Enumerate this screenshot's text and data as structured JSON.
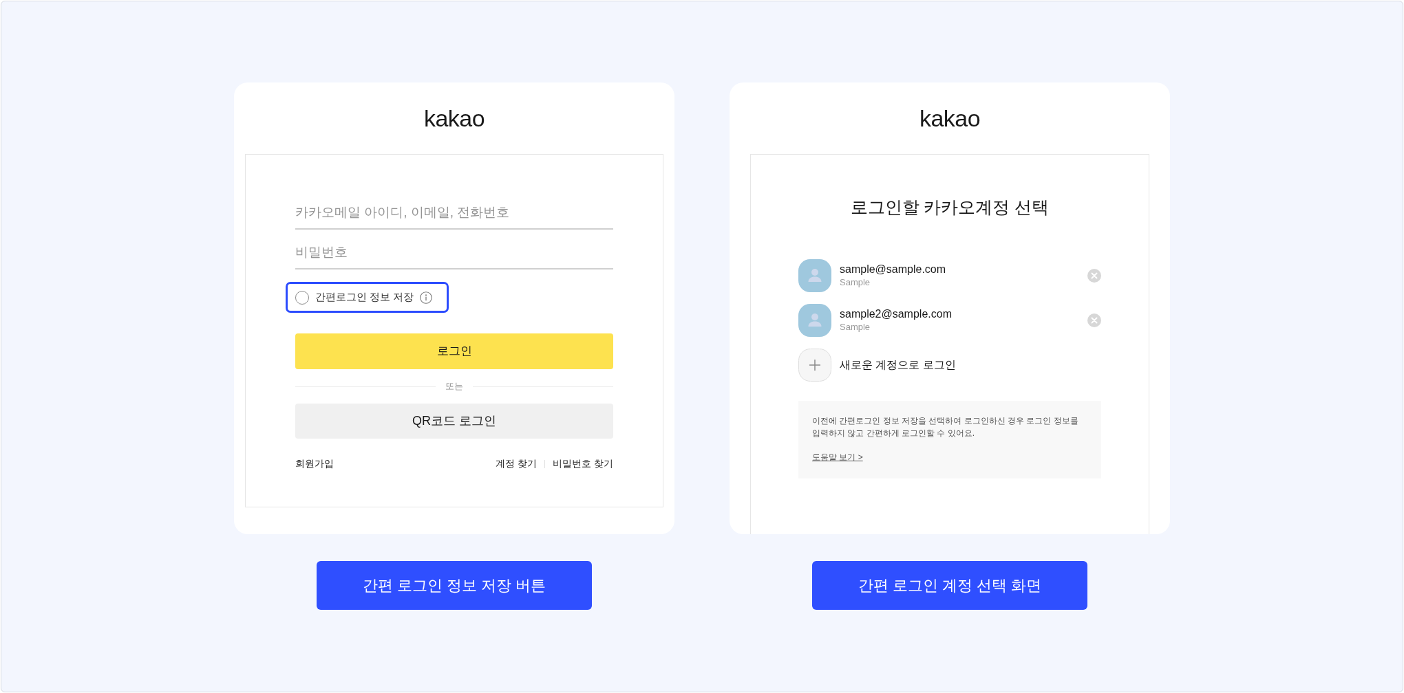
{
  "panels": [
    {
      "kind": "login_form",
      "logo": "kakao",
      "fields": [
        {
          "placeholder": "카카오메일 아이디, 이메일, 전화번호"
        },
        {
          "placeholder": "비밀번호"
        }
      ],
      "save_option": {
        "label": "간편로그인 정보 저장",
        "checked": false,
        "highlighted": true
      },
      "login_button": "로그인",
      "divider": "또는",
      "qr_button": "QR코드 로그인",
      "signup_link": "회원가입",
      "links": [
        "계정 찾기",
        "비밀번호 찾기"
      ]
    },
    {
      "kind": "account_select",
      "logo": "kakao",
      "title": "로그인할 카카오계정 선택",
      "accounts": [
        {
          "email": "sample@sample.com",
          "name": "Sample"
        },
        {
          "email": "sample2@sample.com",
          "name": "Sample"
        }
      ],
      "add_account": "새로운 계정으로 로그인",
      "notice": {
        "text": "이전에 간편로그인 정보 저장을 선택하여 로그인하신 경우 로그인 정보를\n입력하지 않고 간편하게 로그인할 수 있어요.",
        "link": "도움말 보기 >"
      }
    }
  ],
  "captions": [
    "간편 로그인 정보 저장 버튼",
    "간편 로그인 계정 선택 화면"
  ]
}
